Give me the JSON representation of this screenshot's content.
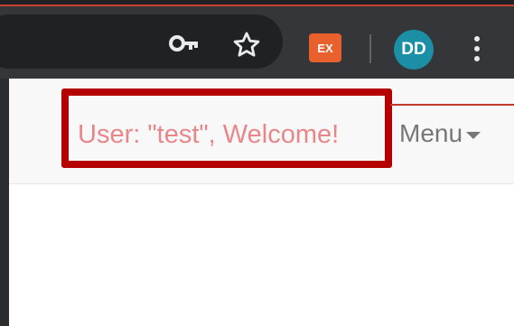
{
  "browser": {
    "extension_label": "EX",
    "profile_initials": "DD",
    "colors": {
      "toolbar": "#35363a",
      "omnibox": "#202124",
      "avatar": "#1a8fa5",
      "extension": "#e8602c"
    }
  },
  "navbar": {
    "welcome_text": "User: \"test\", Welcome!",
    "menu_label": "Menu",
    "colors": {
      "welcome_text": "#e8878a",
      "highlight_border": "#b40000",
      "menu_text": "#777777"
    }
  }
}
